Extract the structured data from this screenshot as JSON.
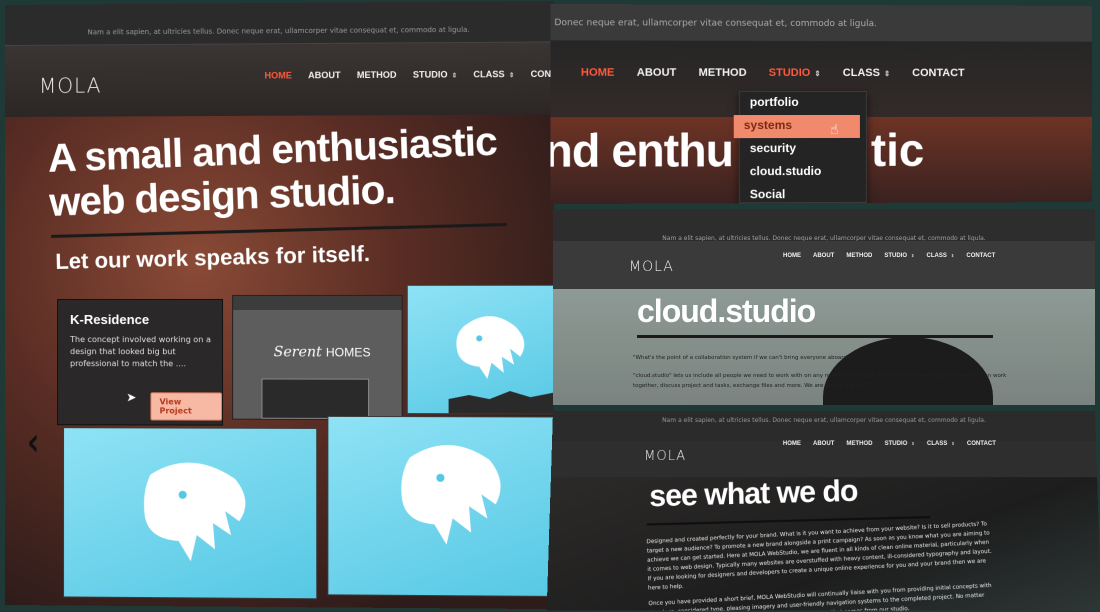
{
  "topbar_text": "Nam a elit sapien, at ultricies tellus. Donec neque erat, ullamcorper vitae consequat et, commodo at ligula.",
  "topbar_text_b": "Donec neque erat, ullamcorper vitae consequat et, commodo at ligula.",
  "topbar_text_small": "Nam a elit sapien, at ultricies tellus. Donec neque erat, ullamcorper vitae consequat et, commodo at ligula.",
  "logo": "MOLA",
  "nav": {
    "home": "HOME",
    "about": "ABOUT",
    "method": "METHOD",
    "studio": "STUDIO",
    "class": "CLASS",
    "contact": "CONTACT",
    "caret": "⇕"
  },
  "hero": {
    "headline_line1": "A small and enthusiastic",
    "headline_line2": "web design studio.",
    "subhead": "Let our work speaks for itself."
  },
  "project_card": {
    "title": "K-Residence",
    "description": "The concept involved working on a design that looked big but professional to match the ....",
    "button": "View Project"
  },
  "serent_card": {
    "logo_script": "Serent",
    "logo_word": "HOMES"
  },
  "dropdown_panel": {
    "big_text_left": "nd enthu",
    "big_text_right": "tic",
    "items": [
      "portfolio",
      "systems",
      "security",
      "cloud.studio",
      "Social"
    ]
  },
  "cloud_panel": {
    "title": "cloud.studio",
    "line1": "\"What's the point of a collaboration system if we can't bring everyone aboard?\"",
    "line2": "\"cloud.studio\" lets us include all people we need to work with on any number of project. Our team will have a place where we can work",
    "line3": "together, discuss project and tasks, exchange files and more. We are Green, are you?"
  },
  "work_panel": {
    "title": "see what we do",
    "para1": "Designed and created perfectly for your brand. What is it you want to achieve from your website? Is it to sell products? To target a new audience? To promote a new brand alongside a print campaign? As soon as you know what you are aiming to achieve we can get started. Here at MOLA WebStudio, we are fluent in all kinds of clean online material, particularly when it comes to web design. Typically many websites are overstuffed with heavy content, ill-considered typography and layout. If you are looking for designers and developers to create a unique online experience for you and your brand then we are here to help.",
    "para2": "Once you have provided a short brief, MOLA WebStudio will continually liaise with you from providing initial concepts with structure, considered type, pleasing imagery and user-friendly navigation systems to the completed project. No matter what the size and scale of the job, we put 100% into everything that comes from our studio."
  },
  "colors": {
    "accent": "#ff5a3c",
    "button_bg": "#f7b9a3",
    "highlight": "#f18a6c",
    "sky": "#56c8e4",
    "border": "#1f3a36"
  },
  "icons": [
    "pointer-cursor-icon",
    "hand-cursor-icon",
    "chevron-left-icon",
    "whale-illustration-icon"
  ]
}
